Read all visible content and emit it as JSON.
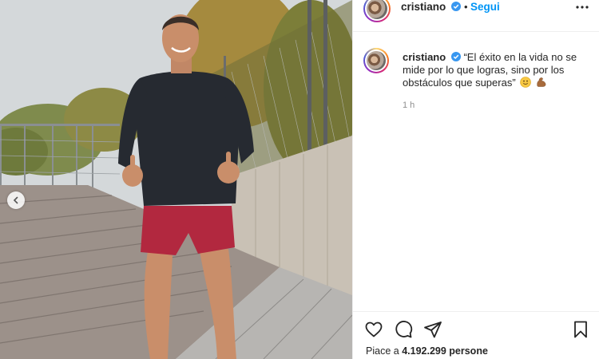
{
  "post": {
    "username": "cristiano",
    "separator": "•",
    "follow_label": "Segui",
    "caption_text": "“El éxito en la vida no se mide por lo que logras, sino por los obstáculos que superas”",
    "emojis": [
      "smiling-face-emoji",
      "flexed-biceps-emoji"
    ],
    "time_ago": "1 h",
    "likes_prefix": "Piace a",
    "likes_count": "4.192.299",
    "likes_suffix": "persone"
  },
  "icons": {
    "verified": "verified-badge-icon",
    "more": "more-options-icon",
    "prev": "chevron-left-icon",
    "like": "heart-icon",
    "comment": "comment-bubble-icon",
    "share": "paper-plane-icon",
    "save": "bookmark-icon"
  },
  "colors": {
    "follow_blue": "#0095f6",
    "verified_blue": "#3897f0",
    "meta_gray": "#8e8e8e",
    "text": "#262626",
    "divider": "#efefef"
  }
}
